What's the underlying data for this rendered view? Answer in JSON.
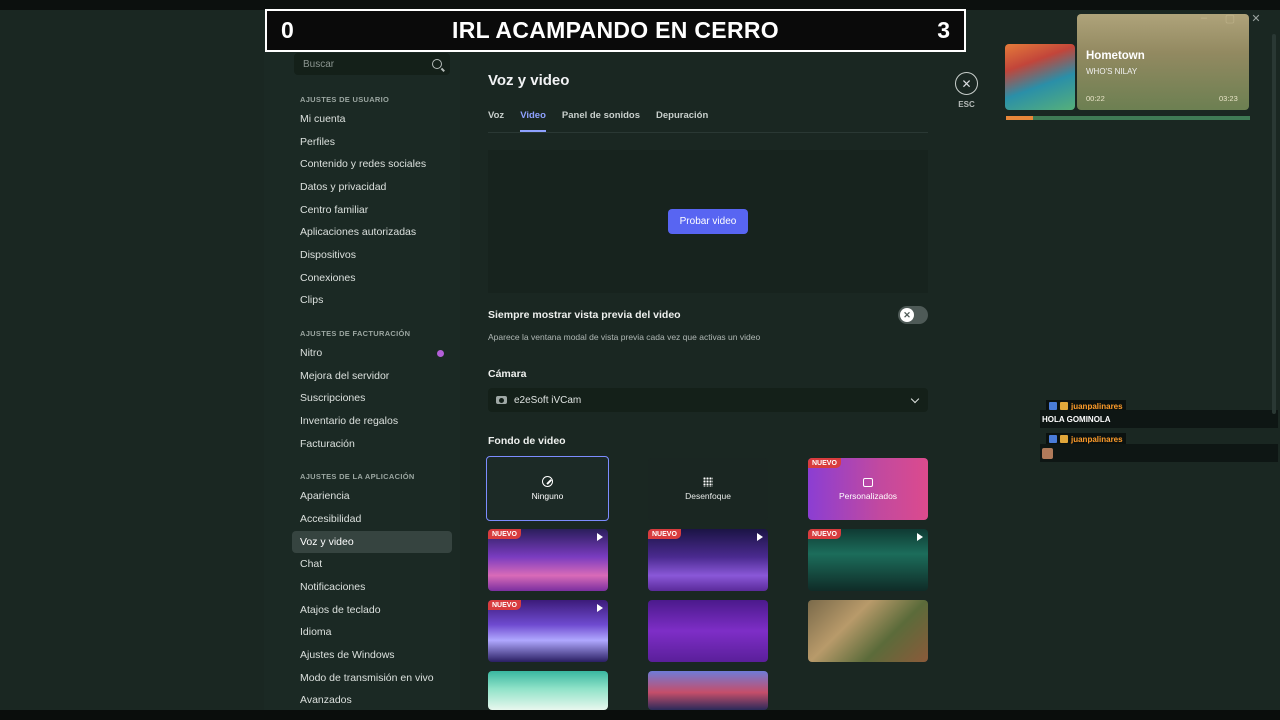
{
  "overlay": {
    "score_left": "0",
    "title": "IRL ACAMPANDO EN CERRO",
    "score_right": "3"
  },
  "search": {
    "placeholder": "Buscar",
    "icon": "search-icon"
  },
  "sidebar": {
    "sections": [
      {
        "header": "AJUSTES DE USUARIO",
        "items": [
          "Mi cuenta",
          "Perfiles",
          "Contenido y redes sociales",
          "Datos y privacidad",
          "Centro familiar",
          "Aplicaciones autorizadas",
          "Dispositivos",
          "Conexiones",
          "Clips"
        ]
      },
      {
        "header": "AJUSTES DE FACTURACIÓN",
        "items": [
          "Nitro",
          "Mejora del servidor",
          "Suscripciones",
          "Inventario de regalos",
          "Facturación"
        ]
      },
      {
        "header": "AJUSTES DE LA APLICACIÓN",
        "items": [
          "Apariencia",
          "Accesibilidad",
          "Voz y video",
          "Chat",
          "Notificaciones",
          "Atajos de teclado",
          "Idioma",
          "Ajustes de Windows",
          "Modo de transmisión en vivo",
          "Avanzados"
        ]
      }
    ],
    "active_item": "Voz y video",
    "nitro_dot_color": "#b35fd8"
  },
  "main": {
    "title": "Voz y video",
    "close_label": "ESC",
    "tabs": [
      "Voz",
      "Video",
      "Panel de sonidos",
      "Depuración"
    ],
    "active_tab": "Video",
    "test_button": "Probar video",
    "preview_toggle": {
      "title": "Siempre mostrar vista previa del video",
      "description": "Aparece la ventana modal de vista previa cada vez que activas un video",
      "enabled": false
    },
    "camera": {
      "label": "Cámara",
      "selected": "e2eSoft iVCam"
    },
    "background": {
      "label": "Fondo de video",
      "tiles": [
        {
          "label": "Ninguno",
          "icon": "none-icon",
          "selected": true
        },
        {
          "label": "Desenfoque",
          "icon": "blur-icon"
        },
        {
          "label": "Personalizados",
          "icon": "image-icon",
          "badge": "NUEVO"
        }
      ],
      "badge_text": "NUEVO"
    }
  },
  "music": {
    "song": "Hometown",
    "artist": "WHO'S NILAY",
    "elapsed": "00:22",
    "total": "03:23",
    "progress": 0.11
  },
  "chat": {
    "messages": [
      {
        "user": "juanpalinares",
        "text": "HOLA GOMINOLA"
      },
      {
        "user": "juanpalinares",
        "text": ""
      }
    ]
  },
  "colors": {
    "accent": "#5865f2",
    "tab_active": "#8ea1ff",
    "badge": "#d83c3e",
    "chat_username": "#ff9c2a"
  }
}
